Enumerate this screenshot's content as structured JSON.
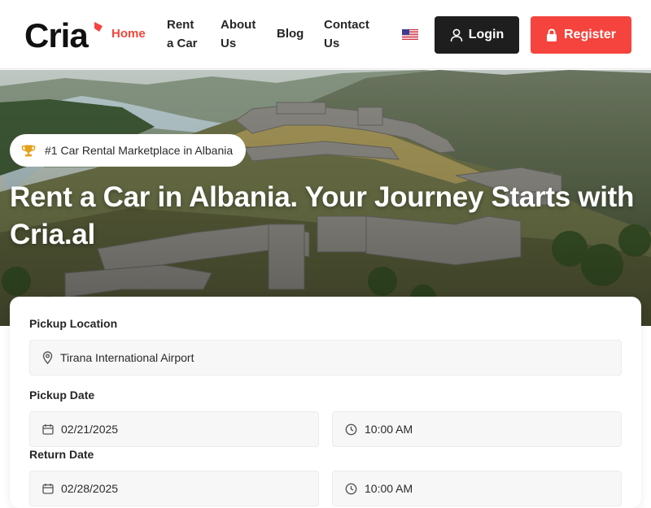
{
  "header": {
    "logo_text": "Cria",
    "nav": [
      {
        "label": "Home",
        "active": true
      },
      {
        "label": "Rent a Car",
        "active": false
      },
      {
        "label": "About Us",
        "active": false
      },
      {
        "label": "Blog",
        "active": false
      },
      {
        "label": "Contact Us",
        "active": false
      }
    ],
    "language_flag_icon": "us-flag-icon",
    "login_label": "Login",
    "register_label": "Register"
  },
  "hero": {
    "badge_icon": "trophy-icon",
    "badge_text": "#1 Car Rental Marketplace in Albania",
    "title": "Rent a Car in Albania. Your Journey Starts with Cria.al"
  },
  "booking": {
    "pickup_location_label": "Pickup Location",
    "pickup_location_value": "Tirana International Airport",
    "pickup_date_label": "Pickup Date",
    "pickup_date_value": "02/21/2025",
    "pickup_time_value": "10:00 AM",
    "return_date_label": "Return Date",
    "return_date_value": "02/28/2025",
    "return_time_value": "10:00 AM"
  },
  "colors": {
    "accent": "#f4443d",
    "dark_button": "#1e1e1e",
    "field_bg": "#f7f7f7"
  }
}
